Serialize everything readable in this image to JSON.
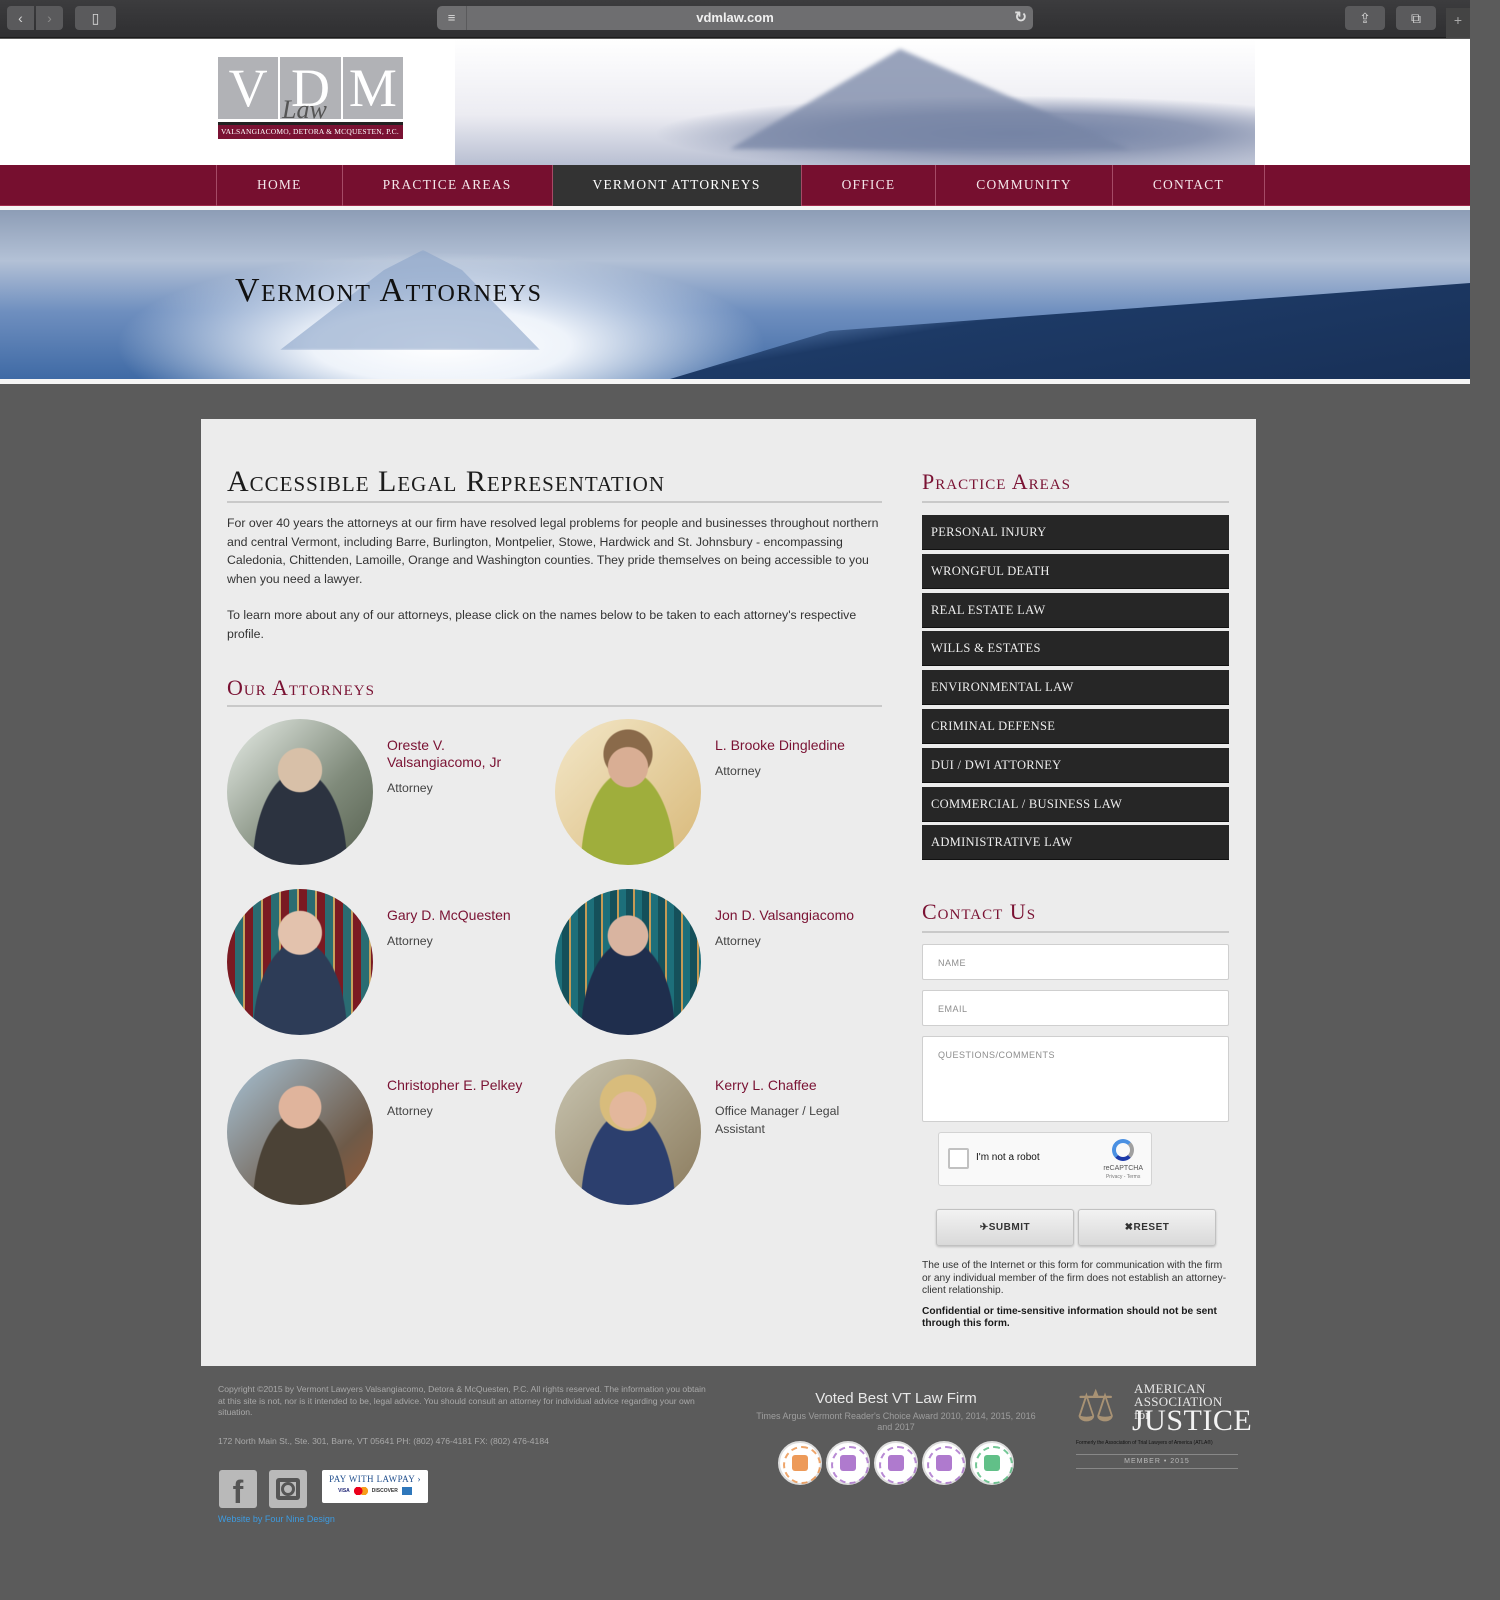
{
  "browser": {
    "url": "vdmlaw.com",
    "back_icon": "‹",
    "forward_icon": "›",
    "sidebar_icon": "▯",
    "reader_icon": "≡",
    "reload_icon": "↻",
    "share_icon": "⇪",
    "tabs_icon": "⧉",
    "newtab_icon": "+"
  },
  "logo": {
    "letters": [
      "V",
      "D",
      "M"
    ],
    "script": "Law",
    "firm_name": "VALSANGIACOMO, DETORA & MCQUESTEN, P.C."
  },
  "nav": {
    "items": [
      "HOME",
      "PRACTICE AREAS",
      "VERMONT ATTORNEYS",
      "OFFICE",
      "COMMUNITY",
      "CONTACT"
    ],
    "active": "VERMONT ATTORNEYS"
  },
  "hero": {
    "title": "Vermont Attorneys"
  },
  "main": {
    "title": "Accessible Legal Representation",
    "paragraphs": [
      "For over 40 years the attorneys at our firm have resolved legal problems for people and businesses throughout northern and central Vermont, including Barre, Burlington, Montpelier, Stowe, Hardwick and St. Johnsbury - encompassing Caledonia, Chittenden, Lamoille, Orange and Washington counties. They pride themselves on being accessible to you when you need a lawyer.",
      "To learn more about any of our attorneys, please click on the names below to be taken to each attorney's respective profile."
    ],
    "attorneys_title": "Our Attorneys",
    "attorneys": [
      {
        "name": "Oreste V. Valsangiacomo, Jr",
        "role": "Attorney"
      },
      {
        "name": "L. Brooke Dingledine",
        "role": "Attorney"
      },
      {
        "name": "Gary D. McQuesten",
        "role": "Attorney"
      },
      {
        "name": "Jon D. Valsangiacomo",
        "role": "Attorney"
      },
      {
        "name": "Christopher E. Pelkey",
        "role": "Attorney"
      },
      {
        "name": "Kerry L. Chaffee",
        "role": "Office Manager / Legal Assistant"
      }
    ]
  },
  "sidebar": {
    "practice_title": "Practice Areas",
    "practice_areas": [
      "PERSONAL INJURY",
      "WRONGFUL DEATH",
      "REAL ESTATE LAW",
      "WILLS & ESTATES",
      "ENVIRONMENTAL LAW",
      "CRIMINAL DEFENSE",
      "DUI / DWI ATTORNEY",
      "COMMERCIAL / BUSINESS LAW",
      "ADMINISTRATIVE LAW"
    ],
    "contact_title": "Contact Us",
    "form": {
      "name_placeholder": "NAME",
      "email_placeholder": "EMAIL",
      "comments_placeholder": "QUESTIONS/COMMENTS",
      "captcha_label": "I'm not a robot",
      "captcha_brand": "reCAPTCHA",
      "captcha_links": "Privacy - Terms",
      "submit_label": "SUBMIT",
      "submit_icon": "✈",
      "reset_label": "RESET",
      "reset_icon": "✖"
    },
    "disclaimer": "The use of the Internet or this form for communication with the firm or any individual member of the firm does not establish an attorney-client relationship.",
    "warning": "Confidential or time-sensitive information should not be sent through this form."
  },
  "footer": {
    "copyright": "Copyright ©2015 by Vermont Lawyers Valsangiacomo, Detora & McQuesten, P.C. All rights reserved. The information you obtain at this site is not, nor is it intended to be, legal advice. You should consult an attorney for individual advice regarding your own situation.",
    "address": "172 North Main St., Ste. 301, Barre, VT 05641 PH: (802) 476-4181 FX: (802) 476-4184",
    "facebook_icon": "f",
    "lawpay_label": "PAY WITH LAWPAY ›",
    "lawpay_cards": [
      "VISA",
      "MC",
      "DISCOVER",
      "AMEX"
    ],
    "credit": "Website by Four Nine Design",
    "voted_title": "Voted Best VT Law Firm",
    "voted_subtitle": "Times Argus Vermont Reader's Choice Award 2010, 2014, 2015, 2016 and 2017",
    "badge_colors": [
      "#e8812f",
      "#9b59c2",
      "#9b59c2",
      "#9b59c2",
      "#3ab06a"
    ],
    "aaj_line1": "AMERICAN",
    "aaj_line1b": "ASSOCIATION for",
    "aaj_line2": "JUSTICE",
    "aaj_line3": "Formerly the Association of Trial Lawyers of America (ATLA®)",
    "aaj_member": "MEMBER • 2015",
    "scales_icon": "⚖"
  },
  "colors": {
    "brand": "#760f2f",
    "nav_active": "#333333",
    "accent_text": "#7a1233"
  }
}
